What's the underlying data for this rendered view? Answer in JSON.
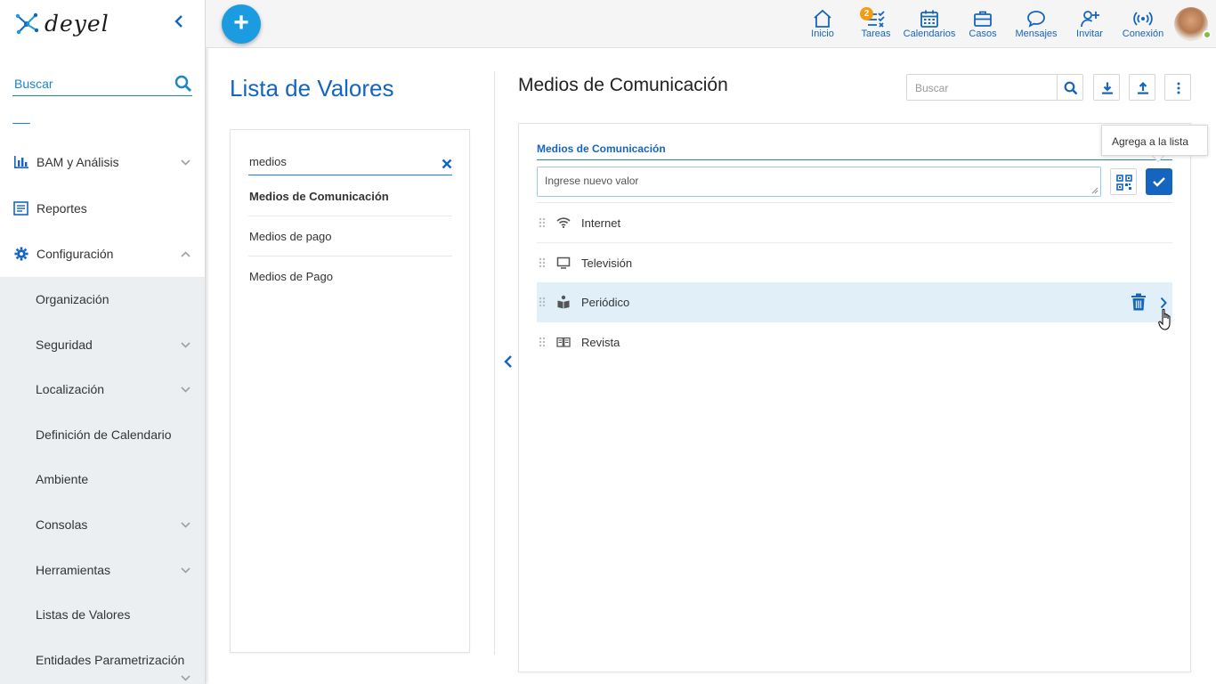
{
  "app": {
    "logo_text": "deyel"
  },
  "sidebar": {
    "search_placeholder": "Buscar",
    "menu": [
      {
        "label": "BAM y Análisis",
        "icon": "bar-chart-icon",
        "expandable": true
      },
      {
        "label": "Reportes",
        "icon": "report-icon",
        "expandable": false
      },
      {
        "label": "Configuración",
        "icon": "gear-icon",
        "expanded": true
      }
    ],
    "submenu": [
      {
        "label": "Organización",
        "expandable": false
      },
      {
        "label": "Seguridad",
        "expandable": true
      },
      {
        "label": "Localización",
        "expandable": true
      },
      {
        "label": "Definición de Calendario",
        "expandable": false
      },
      {
        "label": "Ambiente",
        "expandable": false
      },
      {
        "label": "Consolas",
        "expandable": true
      },
      {
        "label": "Herramientas",
        "expandable": true
      },
      {
        "label": "Listas de Valores",
        "expandable": false
      },
      {
        "label": "Entidades Parametrización",
        "expandable": true
      }
    ]
  },
  "topbar": {
    "add_label": "+",
    "nav": [
      {
        "label": "Inicio",
        "icon": "home-icon"
      },
      {
        "label": "Tareas",
        "icon": "tasks-icon",
        "badge": "2"
      },
      {
        "label": "Calendarios",
        "icon": "calendar-icon"
      },
      {
        "label": "Casos",
        "icon": "briefcase-icon"
      },
      {
        "label": "Mensajes",
        "icon": "chat-icon"
      },
      {
        "label": "Invitar",
        "icon": "invite-user-icon"
      },
      {
        "label": "Conexión",
        "icon": "connection-icon"
      }
    ],
    "status_color": "#7bc043"
  },
  "lista": {
    "title": "Lista de Valores",
    "filter_value": "medios",
    "items": [
      {
        "label": "Medios de Comunicación",
        "active": true
      },
      {
        "label": "Medios de pago",
        "active": false
      },
      {
        "label": "Medios de Pago",
        "active": false
      }
    ]
  },
  "detail": {
    "title": "Medios de Comunicación",
    "search_placeholder": "Buscar",
    "card_label": "Medios de Comunicación",
    "new_value_placeholder": "Ingrese nuevo valor",
    "tooltip": "Agrega a la lista",
    "values": [
      {
        "label": "Internet",
        "icon": "wifi-icon",
        "highlighted": false
      },
      {
        "label": "Televisión",
        "icon": "monitor-icon",
        "highlighted": false
      },
      {
        "label": "Periódico",
        "icon": "newspaper-reader-icon",
        "highlighted": true
      },
      {
        "label": "Revista",
        "icon": "magazine-icon",
        "highlighted": false
      }
    ]
  },
  "colors": {
    "primary": "#1565c0",
    "accent": "#1b9be0",
    "highlight_row": "#e1eff9",
    "badge": "#f39c12"
  }
}
